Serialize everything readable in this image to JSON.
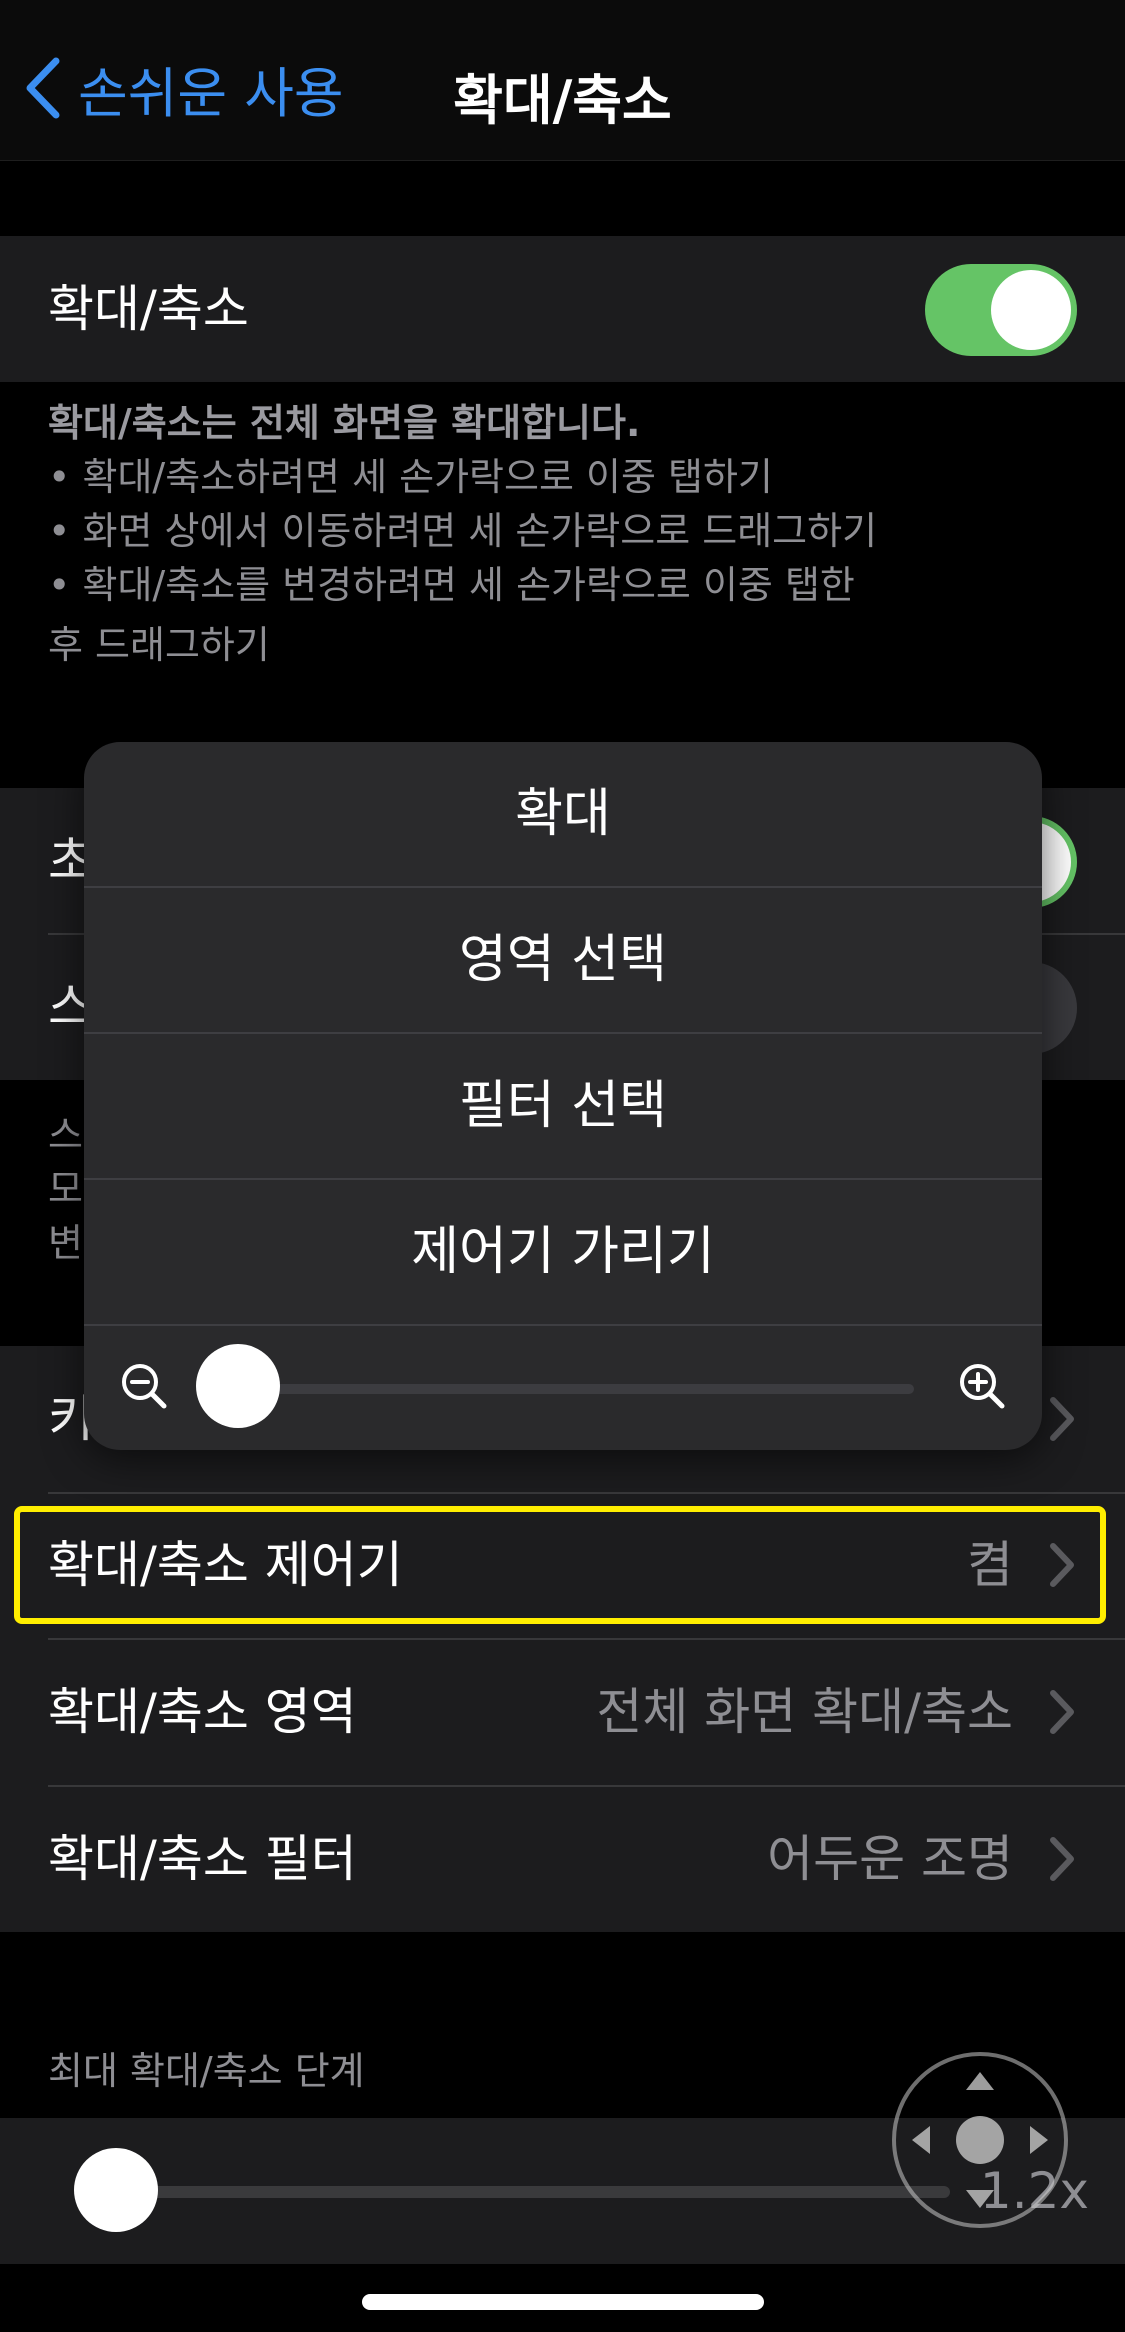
{
  "nav": {
    "back_label": "손쉬운 사용",
    "title": "확대/축소"
  },
  "zoom_toggle": {
    "label": "확대/축소",
    "on": true,
    "on_color": "#65c466"
  },
  "description": {
    "heading": "확대/축소는 전체 화면을 확대합니다.",
    "bullets": [
      "• 확대/축소하려면 세 손가락으로 이중 탭하기",
      "• 화면 상에서 이동하려면 세 손가락으로 드래그하기",
      "• 확대/축소를 변경하려면 세 손가락으로 이중 탭한"
    ],
    "tail": "후 드래그하기"
  },
  "hidden_rows": {
    "row1_prefix": "초",
    "row2_prefix": "스",
    "footer_prefix": [
      "스",
      "모",
      "변"
    ],
    "row3_prefix": "키"
  },
  "settings": [
    {
      "label": "확대/축소 제어기",
      "value": "켬"
    },
    {
      "label": "확대/축소 영역",
      "value": "전체 화면 확대/축소"
    },
    {
      "label": "확대/축소 필터",
      "value": "어두운 조명"
    }
  ],
  "popover": {
    "items": [
      "확대",
      "영역 선택",
      "필터 선택",
      "제어기 가리기"
    ],
    "zoom_level": 0
  },
  "max_zoom": {
    "header": "최대 확대/축소 단계",
    "value": "1.2x"
  },
  "colors": {
    "accent": "#3b8ef0",
    "highlight": "#ffee00"
  }
}
